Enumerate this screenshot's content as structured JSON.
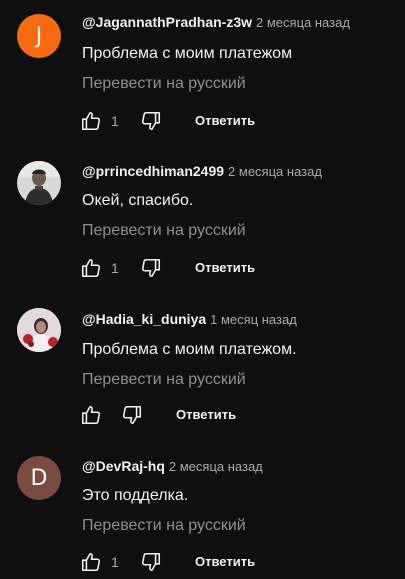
{
  "comments": [
    {
      "avatar_letter": "J",
      "avatar_color": "#f76a10",
      "author": "@JagannathPradhan-z3w",
      "time": "2 месяца назад",
      "text": "Проблема с моим платежом",
      "translate": "Перевести на русский",
      "likes": "1",
      "reply": "Ответить"
    },
    {
      "avatar_letter": "",
      "avatar_color": "#3a3a3a",
      "author": "@prrincedhiman2499",
      "time": "2 месяца назад",
      "text": "Окей, спасибо.",
      "translate": "Перевести на русский",
      "likes": "1",
      "reply": "Ответить"
    },
    {
      "avatar_letter": "",
      "avatar_color": "#cfc6c8",
      "author": "@Hadia_ki_duniya",
      "time": "1 месяц назад",
      "text": "Проблема с моим платежом.",
      "translate": "Перевести на русский",
      "likes": "",
      "reply": "Ответить"
    },
    {
      "avatar_letter": "D",
      "avatar_color": "#7a4b3e",
      "author": "@DevRaj-hq",
      "time": "2 месяца назад",
      "text": "Это подделка.",
      "translate": "Перевести на русский",
      "likes": "1",
      "reply": "Ответить"
    }
  ]
}
